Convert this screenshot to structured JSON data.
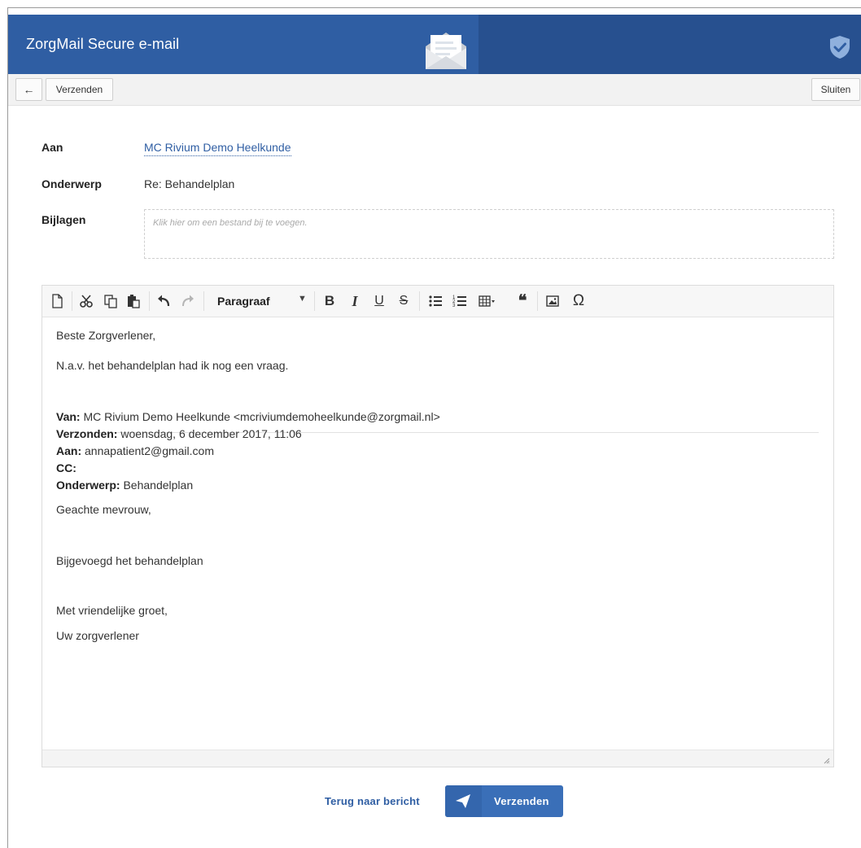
{
  "app": {
    "title": "ZorgMail Secure e-mail"
  },
  "icons": {
    "envelope": "envelope-open-icon",
    "shield": "shield-check-icon",
    "back": "arrow-left-icon",
    "send": "paper-plane-icon"
  },
  "toolbar": {
    "send_label": "Verzenden",
    "close_label": "Sluiten"
  },
  "form": {
    "to_label": "Aan",
    "to_value": "MC Rivium Demo Heelkunde",
    "subject_label": "Onderwerp",
    "subject_value": "Re: Behandelplan",
    "attachments_label": "Bijlagen",
    "attachments_placeholder": "Klik hier om een bestand bij te voegen."
  },
  "editor": {
    "format_select": "Paragraaf",
    "tools": [
      "new-document-icon",
      "cut-icon",
      "copy-icon",
      "paste-icon",
      "undo-icon",
      "redo-icon",
      "bold-icon",
      "italic-icon",
      "underline-icon",
      "strikethrough-icon",
      "bullet-list-icon",
      "numbered-list-icon",
      "table-icon",
      "blockquote-icon",
      "image-icon",
      "special-character-icon"
    ],
    "glyphs": {
      "bold": "B",
      "italic": "I",
      "underline": "U",
      "strike": "S",
      "quote": "❝",
      "omega": "Ω"
    }
  },
  "message": {
    "greeting": "Beste Zorgverlener,",
    "line1": "N.a.v. het behandelplan had ik nog een vraag.",
    "from_label": "Van:",
    "from_value": "MC Rivium Demo Heelkunde <mcriviumdemoheelkunde@zorgmail.nl>",
    "sent_label": "Verzonden:",
    "sent_value": "woensdag, 6 december 2017, 11:06",
    "to_label": "Aan:",
    "to_value": "annapatient2@gmail.com",
    "cc_label": "CC:",
    "subject_label": "Onderwerp:",
    "subject_value": "Behandelplan",
    "salutation": "Geachte mevrouw,",
    "body": "Bijgevoegd het behandelplan",
    "closing": "Met vriendelijke groet,",
    "signature": "Uw zorgverlener"
  },
  "footer": {
    "back_label": "Terug naar bericht",
    "send_label": "Verzenden"
  },
  "colors": {
    "header": "#2f5ea3",
    "header_dark": "#27508f",
    "accent": "#3a6fb8",
    "link": "#2f5ea3"
  }
}
